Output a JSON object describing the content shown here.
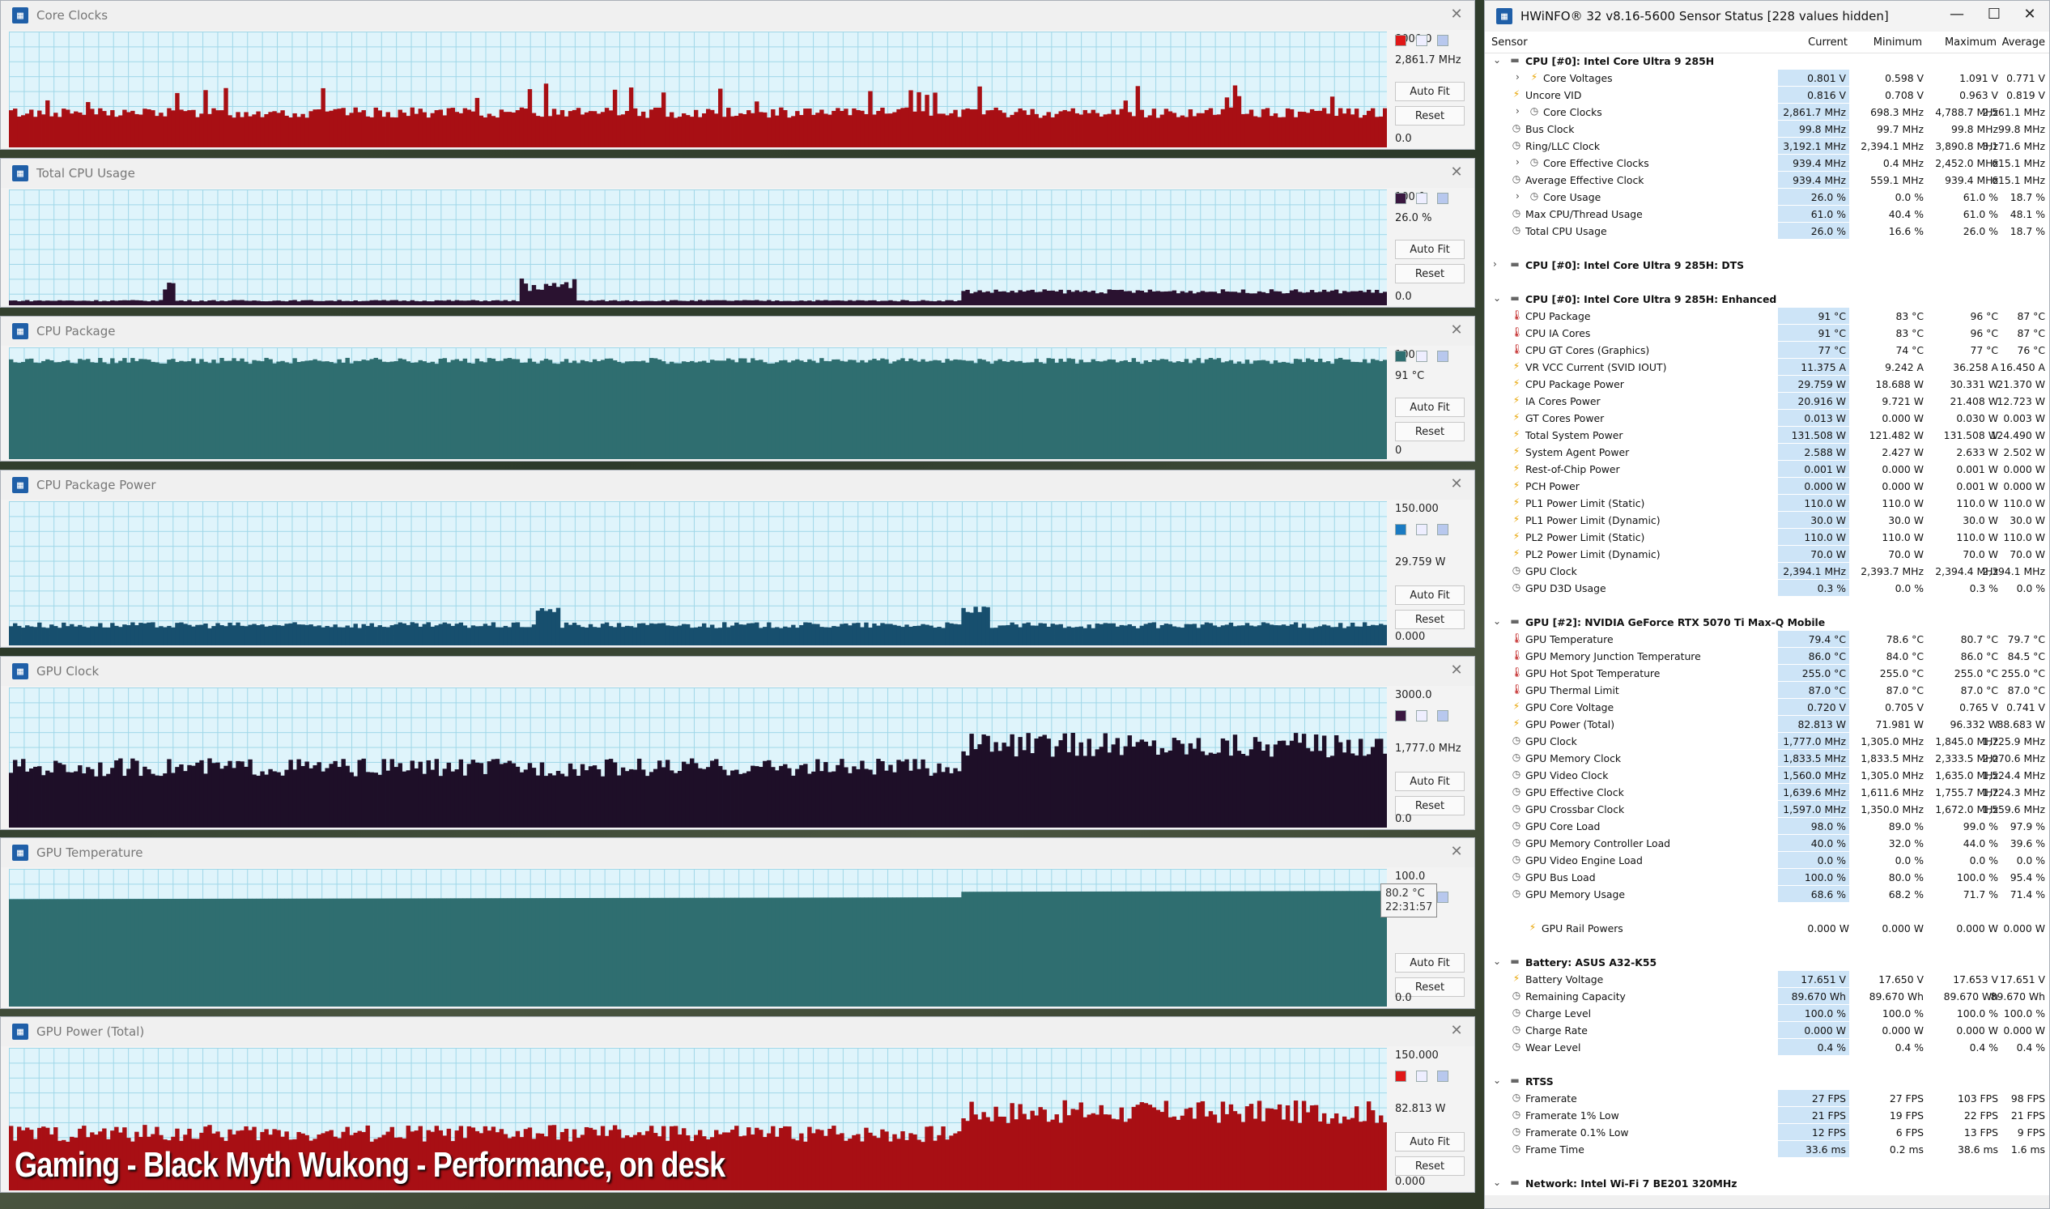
{
  "graphs": [
    {
      "id": "core-clocks",
      "title": "Core Clocks",
      "top": "8000.0",
      "current": "2,861.7 MHz",
      "bottom": "0.0",
      "color": "#a80f14",
      "fill": "#a80f14",
      "level": 0.3,
      "spike": [
        0.4,
        0.55
      ],
      "bump": [],
      "swatch": "#e01818"
    },
    {
      "id": "total-cpu",
      "title": "Total CPU Usage",
      "top": "100.0",
      "current": "26.0 %",
      "bottom": "0.0",
      "color": "#2a1230",
      "fill": "#2a1230",
      "level": 0.04,
      "spike": [],
      "bump": [
        0.69,
        0.12
      ],
      "swatch": "#3a1840"
    },
    {
      "id": "cpu-package",
      "title": "CPU Package",
      "top": "100",
      "current": "91 °C",
      "bottom": "0",
      "color": "#2a6466",
      "fill": "#2f6e70",
      "level": 0.88,
      "spike": [],
      "bump": [],
      "swatch": "#2f6e70"
    },
    {
      "id": "cpu-package-power",
      "title": "CPU Package Power",
      "top": "150.000",
      "current": "29.759 W",
      "bottom": "0.000",
      "color": "#124b6a",
      "fill": "#174f6e",
      "level": 0.14,
      "spike": [],
      "bump": [],
      "swatch": "#1a7ac2"
    },
    {
      "id": "gpu-clock",
      "title": "GPU Clock",
      "top": "3000.0",
      "current": "1,777.0 MHz",
      "bottom": "0.0",
      "color": "#1e0f28",
      "fill": "#1e0f28",
      "level": 0.43,
      "spike": [],
      "bump": [
        0.69,
        0.59
      ],
      "swatch": "#3a1840"
    },
    {
      "id": "gpu-temperature",
      "title": "GPU Temperature",
      "top": "100.0",
      "current": "",
      "bottom": "0.0",
      "color": "#2a6466",
      "fill": "#2f6e70",
      "level": 0.78,
      "spike": [],
      "bump": [
        0.69,
        0.8
      ],
      "swatch": "#2f6e70"
    },
    {
      "id": "gpu-power",
      "title": "GPU Power (Total)",
      "top": "150.000",
      "current": "82.813 W",
      "bottom": "0.000",
      "color": "#a80f14",
      "fill": "#a80f14",
      "level": 0.4,
      "spike": [],
      "bump": [
        0.69,
        0.55
      ],
      "swatch": "#e01818"
    }
  ],
  "buttons": {
    "autofit": "Auto Fit",
    "reset": "Reset"
  },
  "tooltip": {
    "value": "80.2 °C",
    "time": "22:31:57"
  },
  "overlay": "Gaming - Black Myth Wukong - Performance, on desk",
  "hwinfo": {
    "title": "HWiNFO® 32 v8.16-5600 Sensor Status [228 values hidden]",
    "columns": [
      "Sensor",
      "Current",
      "Minimum",
      "Maximum",
      "Average"
    ],
    "rows": [
      {
        "g": 1,
        "n": "CPU [#0]: Intel Core Ultra 9 285H"
      },
      {
        "i": "v",
        "x": 1,
        "n": "Core Voltages",
        "c": "0.801 V",
        "mi": "0.598 V",
        "ma": "1.091 V",
        "a": "0.771 V"
      },
      {
        "i": "v",
        "n": "Uncore VID",
        "c": "0.816 V",
        "mi": "0.708 V",
        "ma": "0.963 V",
        "a": "0.819 V"
      },
      {
        "i": "c",
        "x": 1,
        "n": "Core Clocks",
        "c": "2,861.7 MHz",
        "mi": "698.3 MHz",
        "ma": "4,788.7 MHz",
        "a": "2,561.1 MHz"
      },
      {
        "i": "c",
        "n": "Bus Clock",
        "c": "99.8 MHz",
        "mi": "99.7 MHz",
        "ma": "99.8 MHz",
        "a": "99.8 MHz"
      },
      {
        "i": "c",
        "n": "Ring/LLC Clock",
        "c": "3,192.1 MHz",
        "mi": "2,394.1 MHz",
        "ma": "3,890.8 MHz",
        "a": "3,171.6 MHz"
      },
      {
        "i": "c",
        "x": 1,
        "n": "Core Effective Clocks",
        "c": "939.4 MHz",
        "mi": "0.4 MHz",
        "ma": "2,452.0 MHz",
        "a": "615.1 MHz"
      },
      {
        "i": "c",
        "n": "Average Effective Clock",
        "c": "939.4 MHz",
        "mi": "559.1 MHz",
        "ma": "939.4 MHz",
        "a": "615.1 MHz"
      },
      {
        "i": "c",
        "x": 1,
        "n": "Core Usage",
        "c": "26.0 %",
        "mi": "0.0 %",
        "ma": "61.0 %",
        "a": "18.7 %"
      },
      {
        "i": "c",
        "n": "Max CPU/Thread Usage",
        "c": "61.0 %",
        "mi": "40.4 %",
        "ma": "61.0 %",
        "a": "48.1 %"
      },
      {
        "i": "c",
        "n": "Total CPU Usage",
        "c": "26.0 %",
        "mi": "16.6 %",
        "ma": "26.0 %",
        "a": "18.7 %"
      },
      {
        "blank": 1
      },
      {
        "g": 1,
        "col": 1,
        "n": "CPU [#0]: Intel Core Ultra 9 285H: DTS"
      },
      {
        "blank": 1
      },
      {
        "g": 1,
        "n": "CPU [#0]: Intel Core Ultra 9 285H: Enhanced"
      },
      {
        "i": "t",
        "n": "CPU Package",
        "c": "91 °C",
        "mi": "83 °C",
        "ma": "96 °C",
        "a": "87 °C"
      },
      {
        "i": "t",
        "n": "CPU IA Cores",
        "c": "91 °C",
        "mi": "83 °C",
        "ma": "96 °C",
        "a": "87 °C"
      },
      {
        "i": "t",
        "n": "CPU GT Cores (Graphics)",
        "c": "77 °C",
        "mi": "74 °C",
        "ma": "77 °C",
        "a": "76 °C"
      },
      {
        "i": "v",
        "n": "VR VCC Current (SVID IOUT)",
        "c": "11.375 A",
        "mi": "9.242 A",
        "ma": "36.258 A",
        "a": "16.450 A"
      },
      {
        "i": "v",
        "n": "CPU Package Power",
        "c": "29.759 W",
        "mi": "18.688 W",
        "ma": "30.331 W",
        "a": "21.370 W"
      },
      {
        "i": "v",
        "n": "IA Cores Power",
        "c": "20.916 W",
        "mi": "9.721 W",
        "ma": "21.408 W",
        "a": "12.723 W"
      },
      {
        "i": "v",
        "n": "GT Cores Power",
        "c": "0.013 W",
        "mi": "0.000 W",
        "ma": "0.030 W",
        "a": "0.003 W"
      },
      {
        "i": "v",
        "n": "Total System Power",
        "c": "131.508 W",
        "mi": "121.482 W",
        "ma": "131.508 W",
        "a": "124.490 W"
      },
      {
        "i": "v",
        "n": "System Agent Power",
        "c": "2.588 W",
        "mi": "2.427 W",
        "ma": "2.633 W",
        "a": "2.502 W"
      },
      {
        "i": "v",
        "n": "Rest-of-Chip Power",
        "c": "0.001 W",
        "mi": "0.000 W",
        "ma": "0.001 W",
        "a": "0.000 W"
      },
      {
        "i": "v",
        "n": "PCH Power",
        "c": "0.000 W",
        "mi": "0.000 W",
        "ma": "0.001 W",
        "a": "0.000 W"
      },
      {
        "i": "v",
        "n": "PL1 Power Limit (Static)",
        "c": "110.0 W",
        "mi": "110.0 W",
        "ma": "110.0 W",
        "a": "110.0 W"
      },
      {
        "i": "v",
        "n": "PL1 Power Limit (Dynamic)",
        "c": "30.0 W",
        "mi": "30.0 W",
        "ma": "30.0 W",
        "a": "30.0 W"
      },
      {
        "i": "v",
        "n": "PL2 Power Limit (Static)",
        "c": "110.0 W",
        "mi": "110.0 W",
        "ma": "110.0 W",
        "a": "110.0 W"
      },
      {
        "i": "v",
        "n": "PL2 Power Limit (Dynamic)",
        "c": "70.0 W",
        "mi": "70.0 W",
        "ma": "70.0 W",
        "a": "70.0 W"
      },
      {
        "i": "c",
        "n": "GPU Clock",
        "c": "2,394.1 MHz",
        "mi": "2,393.7 MHz",
        "ma": "2,394.4 MHz",
        "a": "2,394.1 MHz"
      },
      {
        "i": "c",
        "n": "GPU D3D Usage",
        "c": "0.3 %",
        "mi": "0.0 %",
        "ma": "0.3 %",
        "a": "0.0 %"
      },
      {
        "blank": 1
      },
      {
        "g": 1,
        "n": "GPU [#2]: NVIDIA  GeForce RTX 5070 Ti Max-Q Mobile"
      },
      {
        "i": "t",
        "n": "GPU Temperature",
        "c": "79.4 °C",
        "mi": "78.6 °C",
        "ma": "80.7 °C",
        "a": "79.7 °C"
      },
      {
        "i": "t",
        "n": "GPU Memory Junction Temperature",
        "c": "86.0 °C",
        "mi": "84.0 °C",
        "ma": "86.0 °C",
        "a": "84.5 °C"
      },
      {
        "i": "t",
        "n": "GPU Hot Spot Temperature",
        "c": "255.0 °C",
        "mi": "255.0 °C",
        "ma": "255.0 °C",
        "a": "255.0 °C"
      },
      {
        "i": "t",
        "n": "GPU Thermal Limit",
        "c": "87.0 °C",
        "mi": "87.0 °C",
        "ma": "87.0 °C",
        "a": "87.0 °C"
      },
      {
        "i": "v",
        "n": "GPU Core Voltage",
        "c": "0.720 V",
        "mi": "0.705 V",
        "ma": "0.765 V",
        "a": "0.741 V"
      },
      {
        "i": "v",
        "n": "GPU Power (Total)",
        "c": "82.813 W",
        "mi": "71.981 W",
        "ma": "96.332 W",
        "a": "88.683 W"
      },
      {
        "i": "c",
        "n": "GPU Clock",
        "c": "1,777.0 MHz",
        "mi": "1,305.0 MHz",
        "ma": "1,845.0 MHz",
        "a": "1,725.9 MHz"
      },
      {
        "i": "c",
        "n": "GPU Memory Clock",
        "c": "1,833.5 MHz",
        "mi": "1,833.5 MHz",
        "ma": "2,333.5 MHz",
        "a": "2,070.6 MHz"
      },
      {
        "i": "c",
        "n": "GPU Video Clock",
        "c": "1,560.0 MHz",
        "mi": "1,305.0 MHz",
        "ma": "1,635.0 MHz",
        "a": "1,524.4 MHz"
      },
      {
        "i": "c",
        "n": "GPU Effective Clock",
        "c": "1,639.6 MHz",
        "mi": "1,611.6 MHz",
        "ma": "1,755.7 MHz",
        "a": "1,724.3 MHz"
      },
      {
        "i": "c",
        "n": "GPU Crossbar Clock",
        "c": "1,597.0 MHz",
        "mi": "1,350.0 MHz",
        "ma": "1,672.0 MHz",
        "a": "1,559.6 MHz"
      },
      {
        "i": "c",
        "n": "GPU Core Load",
        "c": "98.0 %",
        "mi": "89.0 %",
        "ma": "99.0 %",
        "a": "97.9 %"
      },
      {
        "i": "c",
        "n": "GPU Memory Controller Load",
        "c": "40.0 %",
        "mi": "32.0 %",
        "ma": "44.0 %",
        "a": "39.6 %"
      },
      {
        "i": "c",
        "n": "GPU Video Engine Load",
        "c": "0.0 %",
        "mi": "0.0 %",
        "ma": "0.0 %",
        "a": "0.0 %"
      },
      {
        "i": "c",
        "n": "GPU Bus Load",
        "c": "100.0 %",
        "mi": "80.0 %",
        "ma": "100.0 %",
        "a": "95.4 %"
      },
      {
        "i": "c",
        "n": "GPU Memory Usage",
        "c": "68.6 %",
        "mi": "68.2 %",
        "ma": "71.7 %",
        "a": "71.4 %"
      },
      {
        "blank": 1
      },
      {
        "i": "v",
        "indent": 1,
        "nocur": 1,
        "n": "GPU Rail Powers",
        "c": "0.000 W",
        "mi": "0.000 W",
        "ma": "0.000 W",
        "a": "0.000 W"
      },
      {
        "blank": 1
      },
      {
        "g": 1,
        "n": "Battery: ASUS  A32-K55"
      },
      {
        "i": "v",
        "n": "Battery Voltage",
        "c": "17.651 V",
        "mi": "17.650 V",
        "ma": "17.653 V",
        "a": "17.651 V"
      },
      {
        "i": "c",
        "n": "Remaining Capacity",
        "c": "89.670 Wh",
        "mi": "89.670 Wh",
        "ma": "89.670 Wh",
        "a": "89.670 Wh"
      },
      {
        "i": "c",
        "n": "Charge Level",
        "c": "100.0 %",
        "mi": "100.0 %",
        "ma": "100.0 %",
        "a": "100.0 %"
      },
      {
        "i": "c",
        "n": "Charge Rate",
        "c": "0.000 W",
        "mi": "0.000 W",
        "ma": "0.000 W",
        "a": "0.000 W"
      },
      {
        "i": "c",
        "n": "Wear Level",
        "c": "0.4 %",
        "mi": "0.4 %",
        "ma": "0.4 %",
        "a": "0.4 %"
      },
      {
        "blank": 1
      },
      {
        "g": 1,
        "n": "RTSS"
      },
      {
        "i": "c",
        "n": "Framerate",
        "c": "27 FPS",
        "mi": "27 FPS",
        "ma": "103 FPS",
        "a": "98 FPS"
      },
      {
        "i": "c",
        "n": "Framerate 1% Low",
        "c": "21 FPS",
        "mi": "19 FPS",
        "ma": "22 FPS",
        "a": "21 FPS"
      },
      {
        "i": "c",
        "n": "Framerate 0.1% Low",
        "c": "12 FPS",
        "mi": "6 FPS",
        "ma": "13 FPS",
        "a": "9 FPS"
      },
      {
        "i": "c",
        "n": "Frame Time",
        "c": "33.6 ms",
        "mi": "0.2 ms",
        "ma": "38.6 ms",
        "a": "1.6 ms"
      },
      {
        "blank": 1
      },
      {
        "g": 1,
        "n": "Network: Intel Wi-Fi 7 BE201 320MHz"
      }
    ]
  }
}
